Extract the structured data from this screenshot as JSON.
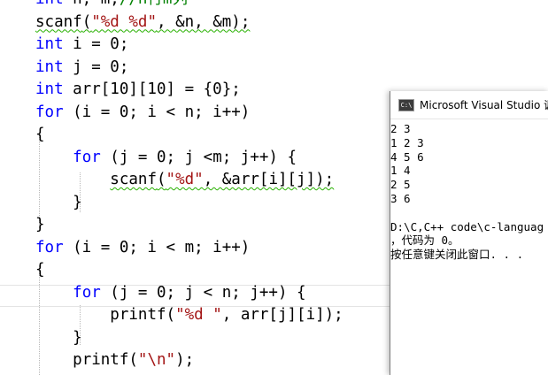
{
  "editor": {
    "lines": [
      {
        "kw": "int",
        "rest": " n, m;",
        "cmt": "//n行m列"
      },
      {
        "fn": "scanf",
        "p1": "(",
        "str": "\"%d %d\"",
        "rest": ", &n, &m);"
      },
      {
        "kw": "int",
        "rest": " i = 0;"
      },
      {
        "kw": "int",
        "rest": " j = 0;"
      },
      {
        "kw": "int",
        "rest": " arr[10][10] = {0};"
      },
      {
        "kw": "for",
        "rest": " (i = 0; i < n; i++)"
      },
      {
        "rest": "{"
      },
      {
        "indent": "    ",
        "kw": "for",
        "rest": " (j = 0; j <m; j++) {"
      },
      {
        "indent": "        ",
        "fn": "scanf",
        "p1": "(",
        "str": "\"%d\"",
        "rest": ", &arr[i][j]);"
      },
      {
        "indent": "    ",
        "rest": "}"
      },
      {
        "rest": "}"
      },
      {
        "kw": "for",
        "rest": " (i = 0; i < m; i++)"
      },
      {
        "rest": "{"
      },
      {
        "indent": "    ",
        "kw": "for",
        "rest": " (j = 0; j < n; j++) {"
      },
      {
        "indent": "        ",
        "fn": "printf",
        "p1": "(",
        "str": "\"%d \"",
        "rest": ", arr[j][i]);"
      },
      {
        "indent": "    ",
        "rest": "}"
      },
      {
        "indent": "    ",
        "fn": "printf",
        "p1": "(",
        "str": "\"\\n\"",
        "rest": ");"
      }
    ]
  },
  "console": {
    "title": "Microsoft Visual Studio 调",
    "icon_text": "C:\\",
    "output": [
      "2 3",
      "1 2 3",
      "4 5 6",
      "1 4",
      "2 5",
      "3 6",
      "",
      "D:\\C,C++ code\\c-languag",
      "，代码为 0。",
      "按任意键关闭此窗口. . ."
    ]
  }
}
